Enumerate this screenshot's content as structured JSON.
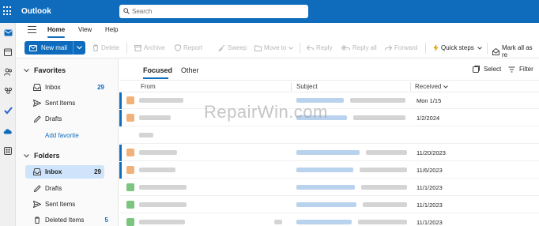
{
  "app": {
    "title": "Outlook"
  },
  "search": {
    "placeholder": "Search"
  },
  "menu": {
    "tabs": [
      {
        "label": "Home"
      },
      {
        "label": "View"
      },
      {
        "label": "Help"
      }
    ]
  },
  "ribbon": {
    "new_mail": "New mail",
    "delete": "Delete",
    "archive": "Archive",
    "report": "Report",
    "sweep": "Sweep",
    "move_to": "Move to",
    "reply": "Reply",
    "reply_all": "Reply all",
    "forward": "Forward",
    "quick_steps": "Quick steps",
    "mark_all": "Mark all as re"
  },
  "nav": {
    "favorites": {
      "label": "Favorites",
      "items": [
        {
          "label": "Inbox",
          "count": "29"
        },
        {
          "label": "Sent Items"
        },
        {
          "label": "Drafts"
        }
      ],
      "add": "Add favorite"
    },
    "folders": {
      "label": "Folders",
      "items": [
        {
          "label": "Inbox",
          "count": "29"
        },
        {
          "label": "Drafts"
        },
        {
          "label": "Sent Items"
        },
        {
          "label": "Deleted Items",
          "count": "5"
        }
      ]
    }
  },
  "list": {
    "tabs": {
      "focused": "Focused",
      "other": "Other"
    },
    "select": "Select",
    "filter": "Filter",
    "columns": {
      "from": "From",
      "subject": "Subject",
      "received": "Received"
    },
    "rows": [
      {
        "date": "Mon 1/15"
      },
      {
        "date": "1/2/2024"
      },
      {
        "date": ""
      },
      {
        "date": "11/20/2023"
      },
      {
        "date": "11/6/2023"
      },
      {
        "date": "11/1/2023"
      },
      {
        "date": "11/1/2023"
      },
      {
        "date": "11/1/2023"
      }
    ]
  },
  "watermark": "RepairWin.com",
  "colors": {
    "brand": "#0f6cbd",
    "selected": "#cfe4fa"
  }
}
